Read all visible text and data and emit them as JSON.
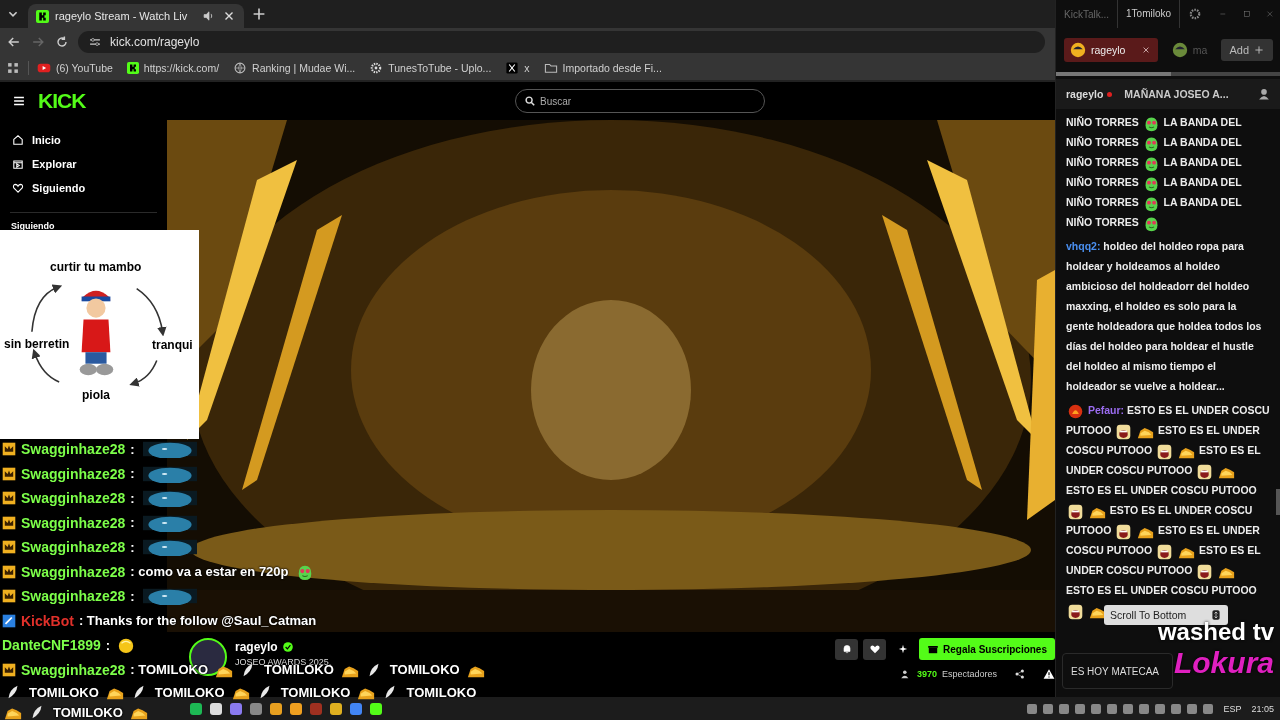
{
  "browser": {
    "tabs": [
      {
        "title": "rageylo Stream - Watch Liv",
        "selected": true
      }
    ],
    "url": "kick.com/rageylo",
    "bookmarks": [
      {
        "kind": "youtube",
        "label": "(6) YouTube"
      },
      {
        "kind": "kick",
        "label": "https://kick.com/"
      },
      {
        "kind": "globe",
        "label": "Ranking | Mudae Wi..."
      },
      {
        "kind": "gear",
        "label": "TunesToTube - Uplo..."
      },
      {
        "kind": "x",
        "label": "x"
      },
      {
        "kind": "folder",
        "label": "Importado desde Fi..."
      }
    ]
  },
  "kick": {
    "logo": "KICK",
    "search_placeholder": "Buscar",
    "nav": [
      {
        "label": "Inicio"
      },
      {
        "label": "Explorar"
      },
      {
        "label": "Siguiendo"
      }
    ],
    "section": "Siguiendo",
    "streamer": {
      "name": "rageylo",
      "verified": true,
      "title": "JOSEO AWARDS 2025."
    },
    "subscribe_button": "Regala Suscripciones",
    "viewers": "3970",
    "viewers_label": "Espectadores"
  },
  "kicktalk": {
    "title": "KickTalk...",
    "user": "1Tomiloko",
    "tabs": [
      {
        "label": "rageylo",
        "selected": true
      },
      {
        "label": "ma",
        "selected": false
      }
    ],
    "add_button": "Add",
    "channel": "rageylo",
    "live": true,
    "pinned": "MAÑANA JOSEO A...",
    "messages": [
      {
        "parts": [
          {
            "kind": "text",
            "text": "NIÑO TORRES"
          },
          {
            "kind": "frog"
          },
          {
            "kind": "text",
            "text": "LA BANDA DEL"
          },
          {
            "kind": "text",
            "text": "NIÑO TORRES"
          },
          {
            "kind": "frog"
          },
          {
            "kind": "text",
            "text": "LA BANDA DEL"
          },
          {
            "kind": "text",
            "text": "NIÑO TORRES"
          },
          {
            "kind": "frog"
          },
          {
            "kind": "text",
            "text": "LA BANDA DEL"
          },
          {
            "kind": "text",
            "text": "NIÑO TORRES"
          },
          {
            "kind": "frog"
          },
          {
            "kind": "text",
            "text": "LA BANDA DEL"
          },
          {
            "kind": "text",
            "text": "NIÑO TORRES"
          },
          {
            "kind": "frog"
          },
          {
            "kind": "text",
            "text": "LA BANDA DEL"
          },
          {
            "kind": "text",
            "text": "NIÑO TORRES"
          },
          {
            "kind": "frog"
          }
        ]
      },
      {
        "user": "vhqq2:",
        "color": "#4a8ff0",
        "parts": [
          {
            "kind": "text",
            "text": "holdeo del holdeo ropa para"
          },
          {
            "kind": "text",
            "text": "holdear y holdeamos al holdeo"
          },
          {
            "kind": "text",
            "text": "ambicioso del holdeadorr del holdeo"
          },
          {
            "kind": "text",
            "text": "maxxing, el holdeo es solo para la"
          },
          {
            "kind": "text",
            "text": "gente holdeadora que holdea todos los"
          },
          {
            "kind": "text",
            "text": "días del holdeo para holdear el hustle"
          },
          {
            "kind": "text",
            "text": "del holdeo al mismo tiempo el"
          },
          {
            "kind": "text",
            "text": "holdeador se vuelve a holdear..."
          }
        ]
      },
      {
        "user": "Pefaur:",
        "color": "#9b6cf0",
        "badge": true,
        "parts": [
          {
            "kind": "text",
            "text": "ESTO ES EL UNDER COSCU"
          },
          {
            "kind": "text",
            "text": "PUTOOO"
          },
          {
            "kind": "cartoon"
          },
          {
            "kind": "gold"
          },
          {
            "kind": "text",
            "text": "ESTO ES EL UNDER"
          },
          {
            "kind": "text",
            "text": "COSCU PUTOOO"
          },
          {
            "kind": "cartoon"
          },
          {
            "kind": "gold"
          },
          {
            "kind": "text",
            "text": "ESTO ES EL"
          },
          {
            "kind": "text",
            "text": "UNDER COSCU PUTOOO"
          },
          {
            "kind": "cartoon"
          },
          {
            "kind": "gold"
          },
          {
            "kind": "text",
            "text": "ESTO ES EL UNDER COSCU PUTOOO"
          },
          {
            "kind": "cartoon"
          },
          {
            "kind": "gold"
          },
          {
            "kind": "text",
            "text": "ESTO ES EL UNDER COSCU"
          },
          {
            "kind": "text",
            "text": "PUTOOO"
          },
          {
            "kind": "cartoon"
          },
          {
            "kind": "gold"
          },
          {
            "kind": "text",
            "text": "ESTO ES EL UNDER"
          },
          {
            "kind": "text",
            "text": "COSCU PUTOOO"
          },
          {
            "kind": "cartoon"
          },
          {
            "kind": "gold"
          },
          {
            "kind": "text",
            "text": "ESTO ES EL"
          },
          {
            "kind": "text",
            "text": "UNDER COSCU PUTOOO"
          },
          {
            "kind": "cartoon"
          },
          {
            "kind": "gold"
          },
          {
            "kind": "text",
            "text": "ESTO ES EL UNDER COSCU PUTOOO"
          },
          {
            "kind": "cartoon"
          },
          {
            "kind": "gold"
          }
        ]
      }
    ],
    "scroll_button": "Scroll To Bottom",
    "input_value": "ES HOY MATECAA"
  },
  "overlay": {
    "meme_labels": [
      "curtir tu mambo",
      "tranqui",
      "piola",
      "sin berretin"
    ],
    "chat": [
      {
        "kind": "crown",
        "user": "Swagginhaze28",
        "color": "#7dff4a",
        "parts": [
          {
            "kind": "text",
            "text": ":"
          },
          {
            "kind": "blob"
          }
        ]
      },
      {
        "kind": "crown",
        "user": "Swagginhaze28",
        "color": "#7dff4a",
        "parts": [
          {
            "kind": "text",
            "text": ":"
          },
          {
            "kind": "blob"
          }
        ]
      },
      {
        "kind": "crown",
        "user": "Swagginhaze28",
        "color": "#7dff4a",
        "parts": [
          {
            "kind": "text",
            "text": ":"
          },
          {
            "kind": "blob"
          }
        ]
      },
      {
        "kind": "crown",
        "user": "Swagginhaze28",
        "color": "#7dff4a",
        "parts": [
          {
            "kind": "text",
            "text": ":"
          },
          {
            "kind": "blob"
          }
        ]
      },
      {
        "kind": "crown",
        "user": "Swagginhaze28",
        "color": "#7dff4a",
        "parts": [
          {
            "kind": "text",
            "text": ":"
          },
          {
            "kind": "blob"
          }
        ]
      },
      {
        "kind": "crown",
        "user": "Swagginhaze28",
        "color": "#7dff4a",
        "parts": [
          {
            "kind": "text",
            "text": ": como va a estar en 720p"
          },
          {
            "kind": "frog"
          }
        ]
      },
      {
        "kind": "crown",
        "user": "Swagginhaze28",
        "color": "#7dff4a",
        "parts": [
          {
            "kind": "text",
            "text": ":"
          },
          {
            "kind": "blob"
          }
        ]
      },
      {
        "kind": "bot",
        "user": "KickBot",
        "color": "#e0302a",
        "parts": [
          {
            "kind": "text",
            "text": ": Thanks for the follow @Saul_Catman"
          }
        ]
      },
      {
        "kind": "plain",
        "user": "DanteCNF1899",
        "color": "#7dff4a",
        "parts": [
          {
            "kind": "text",
            "text": ":"
          },
          {
            "kind": "ball"
          }
        ]
      },
      {
        "kind": "crown",
        "user": "Swagginhaze28",
        "color": "#7dff4a",
        "parts": [
          {
            "kind": "text",
            "text": ": TOMILOKO"
          },
          {
            "kind": "gold"
          },
          {
            "kind": "feather"
          },
          {
            "kind": "text",
            "text": "TOMILOKO"
          },
          {
            "kind": "gold"
          },
          {
            "kind": "feather"
          },
          {
            "kind": "text",
            "text": "TOMILOKO"
          },
          {
            "kind": "gold"
          }
        ]
      },
      {
        "kind": "continuation",
        "parts": [
          {
            "kind": "feather"
          },
          {
            "kind": "text",
            "text": "TOMILOKO"
          },
          {
            "kind": "gold"
          },
          {
            "kind": "feather"
          },
          {
            "kind": "text",
            "text": "TOMILOKO"
          },
          {
            "kind": "gold"
          },
          {
            "kind": "feather"
          },
          {
            "kind": "text",
            "text": "TOMILOKO"
          },
          {
            "kind": "gold"
          },
          {
            "kind": "feather"
          },
          {
            "kind": "text",
            "text": "TOMILOKO"
          }
        ]
      },
      {
        "kind": "continuation",
        "parts": [
          {
            "kind": "gold"
          },
          {
            "kind": "feather"
          },
          {
            "kind": "text",
            "text": "TOMILOKO"
          },
          {
            "kind": "gold"
          }
        ]
      }
    ],
    "captions": [
      {
        "text": "washed tv",
        "color": "#ffffff"
      },
      {
        "text": "Lokura",
        "color": "#e020c0"
      }
    ]
  },
  "taskbar": {
    "language": "ESP",
    "time": "21:05"
  }
}
